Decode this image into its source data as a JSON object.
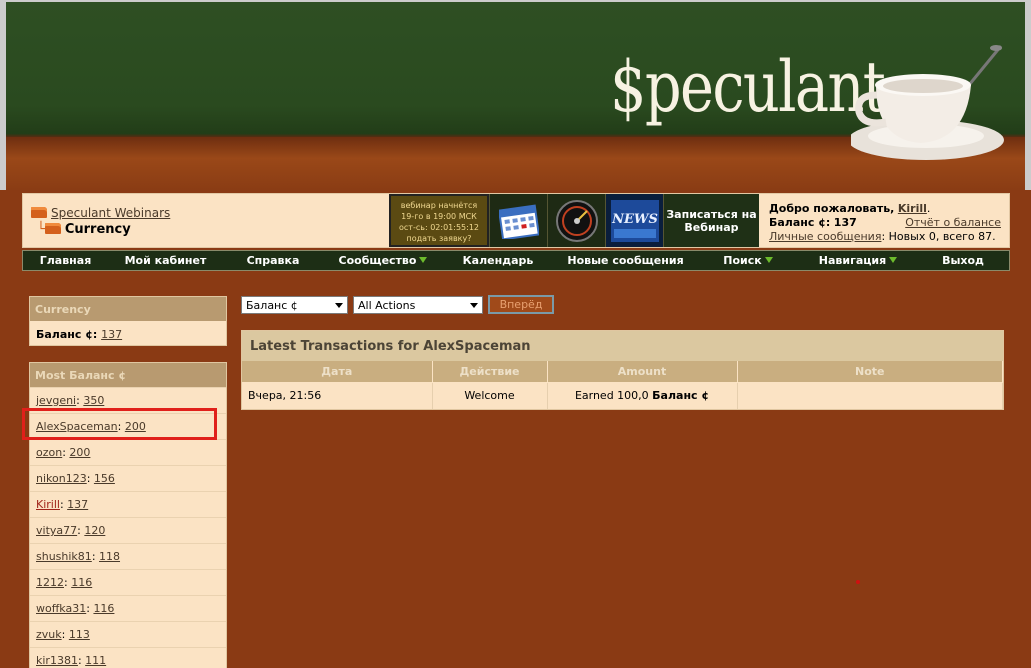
{
  "logo": {
    "text": "$peculant"
  },
  "breadcrumb": {
    "parent": "Speculant Webinars",
    "current": "Currency"
  },
  "promo": {
    "webinar_lines": [
      "вебинар начнётся",
      "19-го в 19:00 МСК",
      "ост-сь: 02:01:55:12",
      "подать заявку?"
    ],
    "news_label": "NEWS",
    "signup_line1": "Записаться на",
    "signup_line2": "Вебинар"
  },
  "welcome": {
    "greeting": "Добро пожаловать,",
    "username": "Kirill",
    "period": ".",
    "balance_label": "Баланс ¢:",
    "balance_value": "137",
    "balance_report": "Отчёт о балансе",
    "messages_link": "Личные сообщения",
    "messages_text": ": Новых 0, всего 87."
  },
  "nav": {
    "items": [
      {
        "label": "Главная"
      },
      {
        "label": "Мой кабинет"
      },
      {
        "label": "Справка"
      },
      {
        "label": "Сообщество",
        "dropdown": true
      },
      {
        "label": "Календарь"
      },
      {
        "label": "Новые сообщения"
      },
      {
        "label": "Поиск",
        "dropdown": true
      },
      {
        "label": "Навигация",
        "dropdown": true
      },
      {
        "label": "Выход"
      }
    ]
  },
  "sidebar": {
    "currency": {
      "title": "Currency",
      "label": "Баланс ¢",
      "value": "137"
    },
    "most": {
      "title": "Most Баланс ¢",
      "users": [
        {
          "name": "jevgeni",
          "value": "350"
        },
        {
          "name": "AlexSpaceman",
          "value": "200"
        },
        {
          "name": "ozon",
          "value": "200"
        },
        {
          "name": "nikon123",
          "value": "156"
        },
        {
          "name": "Kirill",
          "value": "137"
        },
        {
          "name": "vitya77",
          "value": "120"
        },
        {
          "name": "shushik81",
          "value": "118"
        },
        {
          "name": "1212",
          "value": "116"
        },
        {
          "name": "woffka31",
          "value": "116"
        },
        {
          "name": "zvuk",
          "value": "113"
        },
        {
          "name": "kir1381",
          "value": "111"
        }
      ]
    }
  },
  "filters": {
    "currency_select": "Баланс ¢",
    "action_select": "All Actions",
    "go_label": "Вперёд"
  },
  "transactions": {
    "title": "Latest Transactions for AlexSpaceman",
    "columns": [
      "Дата",
      "Действие",
      "Amount",
      "Note"
    ],
    "rows": [
      {
        "date": "Вчера, 21:56",
        "action": "Welcome",
        "amount_text": "Earned 100,0 ",
        "amount_unit": "Баланс ¢",
        "note": ""
      }
    ]
  },
  "colors": {
    "header_green": "#2a4a1f",
    "page_brown": "#8a3a14",
    "panel_cream": "#fbe3c4",
    "nav_dark": "#1d2e15",
    "highlight_red": "#e0201a"
  }
}
